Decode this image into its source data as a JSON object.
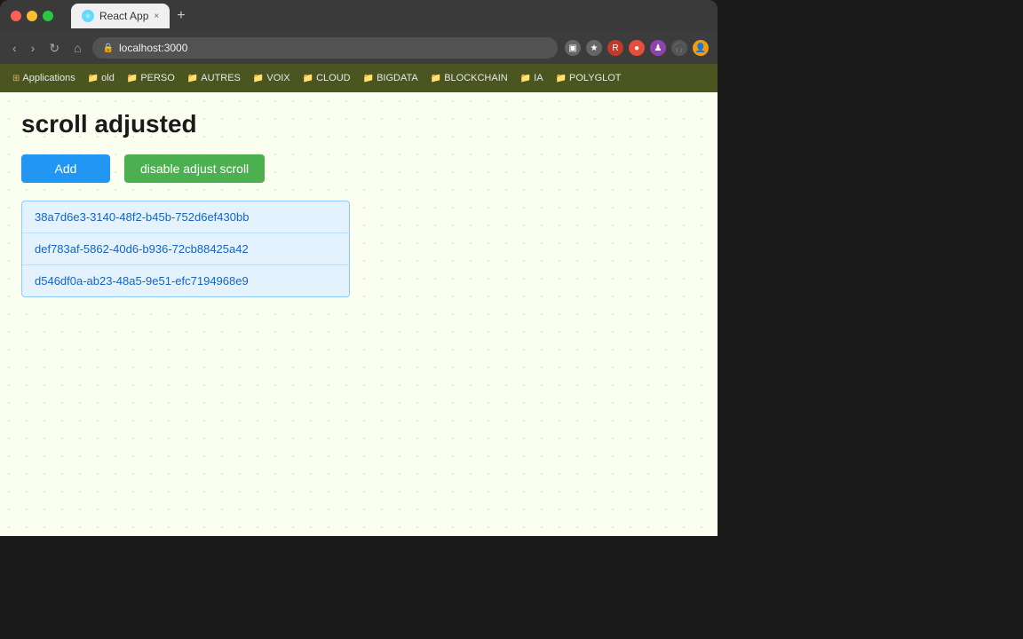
{
  "browser": {
    "title_bar": {
      "tab_label": "React App",
      "tab_close": "×",
      "new_tab": "+"
    },
    "address_bar": {
      "back": "‹",
      "forward": "›",
      "reload": "↻",
      "home": "⌂",
      "url": "localhost:3000",
      "lock_icon": "🔒"
    },
    "bookmarks": [
      {
        "label": "Applications",
        "icon": "⊞"
      },
      {
        "label": "old",
        "icon": "📁"
      },
      {
        "label": "PERSO",
        "icon": "📁"
      },
      {
        "label": "AUTRES",
        "icon": "📁"
      },
      {
        "label": "VOIX",
        "icon": "📁"
      },
      {
        "label": "CLOUD",
        "icon": "📁"
      },
      {
        "label": "BIGDATA",
        "icon": "📁"
      },
      {
        "label": "BLOCKCHAIN",
        "icon": "📁"
      },
      {
        "label": "IA",
        "icon": "📁"
      },
      {
        "label": "POLYGLOT",
        "icon": "📁"
      }
    ]
  },
  "page": {
    "title": "scroll adjusted",
    "add_button_label": "Add",
    "disable_button_label": "disable adjust scroll",
    "list_items": [
      "38a7d6e3-3140-48f2-b45b-752d6ef430bb",
      "def783af-5862-40d6-b936-72cb88425a42",
      "d546df0a-ab23-48a5-9e51-efc7194968e9"
    ]
  }
}
